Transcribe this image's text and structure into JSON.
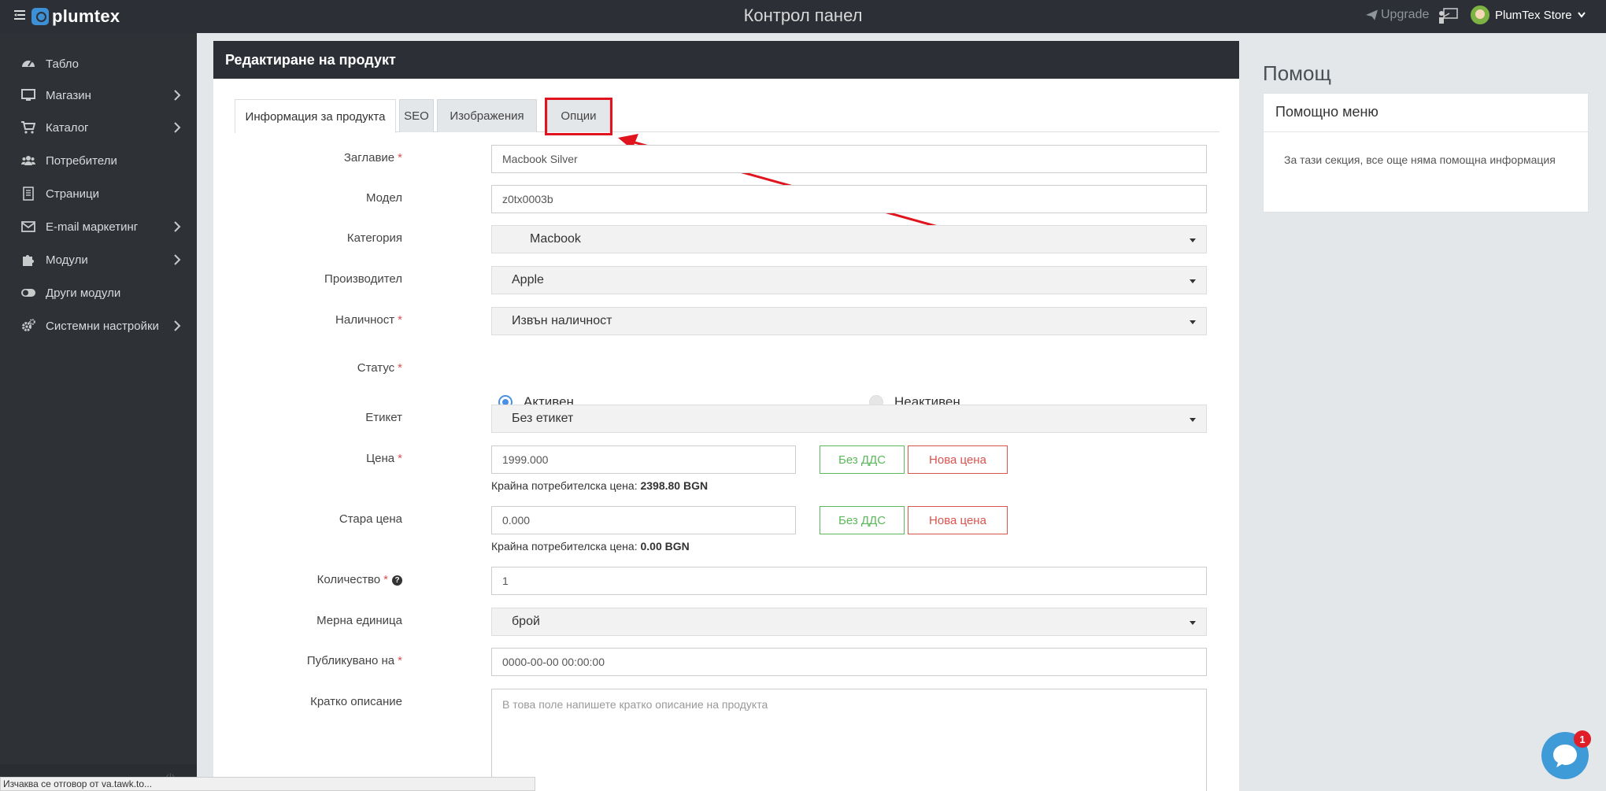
{
  "app": {
    "logo_text": "plumtex",
    "page_heading": "Контрол панел",
    "upgrade_label": "Upgrade",
    "store_name": "PlumTex Store"
  },
  "sidebar": {
    "items": [
      {
        "label": "Табло",
        "icon": "dashboard-icon",
        "has_submenu": false
      },
      {
        "label": "Магазин",
        "icon": "monitor-icon",
        "has_submenu": true
      },
      {
        "label": "Каталог",
        "icon": "cart-icon",
        "has_submenu": true
      },
      {
        "label": "Потребители",
        "icon": "users-icon",
        "has_submenu": false
      },
      {
        "label": "Страници",
        "icon": "document-icon",
        "has_submenu": false
      },
      {
        "label": "E-mail маркетинг",
        "icon": "envelope-icon",
        "has_submenu": true
      },
      {
        "label": "Модули",
        "icon": "puzzle-icon",
        "has_submenu": true
      },
      {
        "label": "Други модули",
        "icon": "toggle-icon",
        "has_submenu": false
      },
      {
        "label": "Системни настройки",
        "icon": "cogs-icon",
        "has_submenu": true
      }
    ]
  },
  "card": {
    "title": "Редактиране на продукт",
    "tabs": [
      {
        "label": "Информация за продукта",
        "active": true
      },
      {
        "label": "SEO",
        "active": false
      },
      {
        "label": "Изображения",
        "active": false
      },
      {
        "label": "Опции",
        "active": false,
        "highlighted": true
      }
    ]
  },
  "form": {
    "title": {
      "label": "Заглавие",
      "required": "*",
      "value": "Macbook Silver"
    },
    "model": {
      "label": "Модел",
      "value": "z0tx0003b"
    },
    "category": {
      "label": "Категория",
      "value": "Macbook"
    },
    "manufacturer": {
      "label": "Производител",
      "value": "Apple"
    },
    "availability": {
      "label": "Наличност",
      "required": "*",
      "value": "Извън наличност"
    },
    "status": {
      "label": "Статус",
      "required": "*",
      "options": [
        "Активен",
        "Неактивен"
      ],
      "selected": "Активен"
    },
    "tag": {
      "label": "Етикет",
      "value": "Без етикет"
    },
    "price": {
      "label": "Цена",
      "required": "*",
      "value": "1999.000",
      "hint_label": "Крайна потребителска цена:",
      "hint_value": "2398.80 BGN",
      "vat_button": "Без ДДС",
      "new_price_button": "Нова цена"
    },
    "old_price": {
      "label": "Стара цена",
      "value": "0.000",
      "hint_label": "Крайна потребителска цена:",
      "hint_value": "0.00 BGN",
      "vat_button": "Без ДДС",
      "new_price_button": "Нова цена"
    },
    "quantity": {
      "label": "Количество",
      "required": "*",
      "value": "1"
    },
    "unit": {
      "label": "Мерна единица",
      "value": "брой"
    },
    "published": {
      "label": "Публикувано на",
      "required": "*",
      "value": "0000-00-00 00:00:00"
    },
    "short_description": {
      "label": "Кратко описание",
      "placeholder": "В това поле напишете кратко описание на продукта"
    }
  },
  "help": {
    "title": "Помощ",
    "card_title": "Помощно меню",
    "body": "За тази секция, все още няма помощна информация"
  },
  "chat": {
    "badge": "1"
  },
  "statusbar": {
    "text": "Изчаква се отговор от va.tawk.to..."
  },
  "colors": {
    "topbar": "#2c3036",
    "sidebar": "#2e3136",
    "accent": "#4a90e2",
    "required": "#d9534f",
    "success": "#5cb85c",
    "highlight": "#e0141e"
  }
}
